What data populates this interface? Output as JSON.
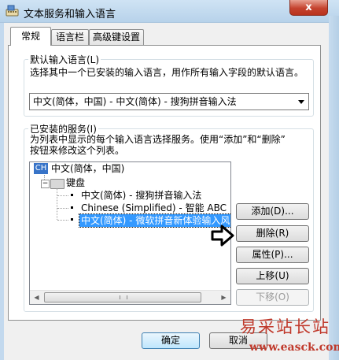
{
  "window": {
    "title": "文本服务和输入语言",
    "close_label": "x",
    "accent": "#3399ff"
  },
  "tabs": [
    {
      "label": "常规",
      "selected": true
    },
    {
      "label": "语言栏",
      "selected": false
    },
    {
      "label": "高级键设置",
      "selected": false
    }
  ],
  "default_lang": {
    "legend": "默认输入语言(L)",
    "description": "选择其中一个已安装的输入语言，用作所有输入字段的默认语言。",
    "selected": "中文(简体，中国) - 中文(简体) - 搜狗拼音输入法"
  },
  "installed": {
    "legend": "已安装的服务(I)",
    "description_line1": "为列表中显示的每个输入语言选择服务。使用“添加”和“删除”",
    "description_line2": "按钮来修改这个列表。",
    "tree": {
      "lang_badge": "CH",
      "lang_label": "中文(简体，中国)",
      "group_label": "键盘",
      "items": [
        "中文(简体) - 搜狗拼音输入法",
        "Chinese (Simplified) - 智能 ABC",
        "中文(简体) - 微软拼音新体验输入风格"
      ],
      "selected_index": 2
    }
  },
  "buttons": {
    "add": "添加(D)...",
    "remove": "删除(R)",
    "properties": "属性(P)...",
    "move_up": "上移(U)",
    "move_down": "下移(O)",
    "ok": "确定",
    "cancel": "取消"
  },
  "watermark": {
    "brand": "易采站长站",
    "url": "www.easck.com"
  }
}
